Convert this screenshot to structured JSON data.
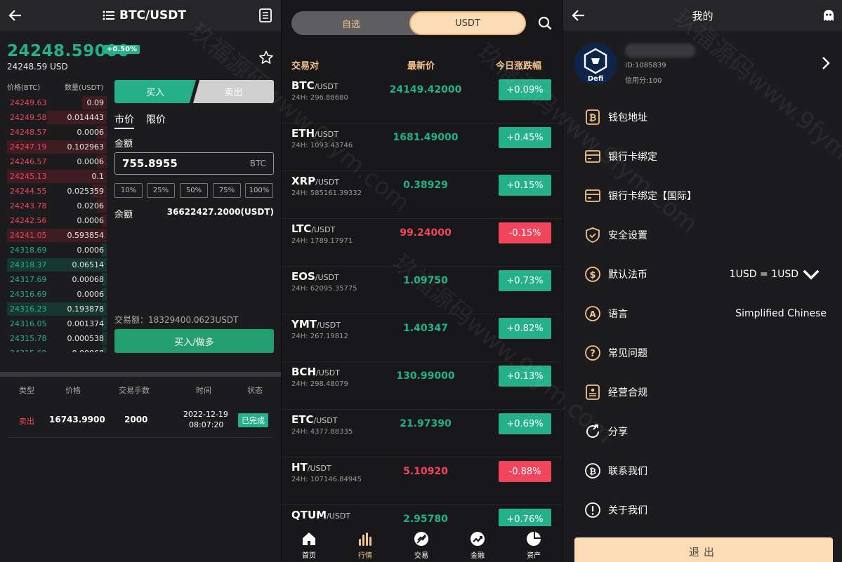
{
  "trade": {
    "title": "BTC/USDT",
    "price": "24248.59000",
    "change_badge": "+0.50%",
    "price_usd": "24248.59 USD",
    "orderbook_header": {
      "price": "价格(BTC)",
      "qty": "数量(USDT)"
    },
    "orderbook": [
      {
        "side": "sell",
        "price": "24249.63",
        "qty": "0.09",
        "depth": 0.25
      },
      {
        "side": "sell",
        "price": "24249.58",
        "qty": "0.014443",
        "depth": 0.6
      },
      {
        "side": "sell",
        "price": "24248.57",
        "qty": "0.0006",
        "depth": 0.1
      },
      {
        "side": "sell",
        "price": "24247.19",
        "qty": "0.102963",
        "depth": 1.0
      },
      {
        "side": "sell",
        "price": "24246.57",
        "qty": "0.0006",
        "depth": 0.1
      },
      {
        "side": "sell",
        "price": "24245.13",
        "qty": "0.1",
        "depth": 1.0
      },
      {
        "side": "sell",
        "price": "24244.55",
        "qty": "0.025359",
        "depth": 0.15
      },
      {
        "side": "sell",
        "price": "24243.78",
        "qty": "0.0206",
        "depth": 0.1
      },
      {
        "side": "sell",
        "price": "24242.56",
        "qty": "0.0006",
        "depth": 0.05
      },
      {
        "side": "sell",
        "price": "24241.05",
        "qty": "0.593854",
        "depth": 1.0
      },
      {
        "side": "buy",
        "price": "24318.69",
        "qty": "0.0006",
        "depth": 0.05
      },
      {
        "side": "buy",
        "price": "24318.37",
        "qty": "0.06514",
        "depth": 1.0
      },
      {
        "side": "buy",
        "price": "24317.69",
        "qty": "0.00068",
        "depth": 0.05
      },
      {
        "side": "buy",
        "price": "24316.69",
        "qty": "0.0006",
        "depth": 0.05
      },
      {
        "side": "buy",
        "price": "24316.23",
        "qty": "0.193878",
        "depth": 1.0
      },
      {
        "side": "buy",
        "price": "24316.05",
        "qty": "0.001374",
        "depth": 0.05
      },
      {
        "side": "buy",
        "price": "24315.78",
        "qty": "0.000538",
        "depth": 0.05
      },
      {
        "side": "buy",
        "price": "24315.69",
        "qty": "0.00068",
        "depth": 0.05
      }
    ],
    "buy_tab": "买入",
    "sell_tab": "卖出",
    "order_type_market": "市价",
    "order_type_limit": "限价",
    "amount_label": "金额",
    "amount_value": "755.8955",
    "amount_unit": "BTC",
    "pct_buttons": [
      "10%",
      "25%",
      "50%",
      "75%",
      "100%"
    ],
    "balance_label": "余额",
    "balance_value": "36622427.2000(USDT)",
    "volume_text": "交易额：18329400.0623USDT",
    "submit_label": "买入/做多",
    "history_headers": [
      "类型",
      "价格",
      "交易手数",
      "时间",
      "状态"
    ],
    "history_row": {
      "type": "卖出",
      "price": "16743.9900",
      "lots": "2000",
      "date": "2022-12-19",
      "time": "08:07:20",
      "status": "已完成"
    }
  },
  "market": {
    "tab_fav": "自选",
    "tab_usdt": "USDT",
    "headers": [
      "交易对",
      "最新价",
      "今日涨跌幅"
    ],
    "rows": [
      {
        "sym": "BTC",
        "quote": "/USDT",
        "vol": "24H: 296.88680",
        "price": "24149.42000",
        "chg": "+0.09%",
        "up": true
      },
      {
        "sym": "ETH",
        "quote": "/USDT",
        "vol": "24H: 1093.43746",
        "price": "1681.49000",
        "chg": "+0.45%",
        "up": true
      },
      {
        "sym": "XRP",
        "quote": "/USDT",
        "vol": "24H: 585161.39332",
        "price": "0.38929",
        "chg": "+0.15%",
        "up": true
      },
      {
        "sym": "LTC",
        "quote": "/USDT",
        "vol": "24H: 1789.17971",
        "price": "99.24000",
        "chg": "-0.15%",
        "up": false
      },
      {
        "sym": "EOS",
        "quote": "/USDT",
        "vol": "24H: 62095.35775",
        "price": "1.09750",
        "chg": "+0.73%",
        "up": true
      },
      {
        "sym": "YMT",
        "quote": "/USDT",
        "vol": "24H: 267.19812",
        "price": "1.40347",
        "chg": "+0.82%",
        "up": true
      },
      {
        "sym": "BCH",
        "quote": "/USDT",
        "vol": "24H: 298.48079",
        "price": "130.99000",
        "chg": "+0.13%",
        "up": true
      },
      {
        "sym": "ETC",
        "quote": "/USDT",
        "vol": "24H: 4377.88335",
        "price": "21.97390",
        "chg": "+0.69%",
        "up": true
      },
      {
        "sym": "HT",
        "quote": "/USDT",
        "vol": "24H: 107146.84945",
        "price": "5.10920",
        "chg": "-0.88%",
        "up": false
      },
      {
        "sym": "QTUM",
        "quote": "/USDT",
        "vol": "",
        "price": "2.95780",
        "chg": "+0.76%",
        "up": true
      }
    ],
    "tabbar": [
      {
        "label": "首页",
        "icon": "home-icon"
      },
      {
        "label": "行情",
        "icon": "market-icon"
      },
      {
        "label": "交易",
        "icon": "trade-icon"
      },
      {
        "label": "金融",
        "icon": "finance-icon"
      },
      {
        "label": "资产",
        "icon": "assets-icon"
      }
    ],
    "colors": {
      "up": "#25b08a",
      "down": "#f0455d",
      "accent": "#f5c48e"
    }
  },
  "profile": {
    "title": "我的",
    "avatar_text": "Defi",
    "user_id": "ID:1085839",
    "credit": "信用分:100",
    "menu": [
      {
        "label": "钱包地址",
        "icon": "bitcoin-wallet-icon",
        "value": ""
      },
      {
        "label": "银行卡绑定",
        "icon": "card-icon",
        "value": ""
      },
      {
        "label": "银行卡绑定【国际】",
        "icon": "card-icon",
        "value": ""
      },
      {
        "label": "安全设置",
        "icon": "shield-icon",
        "value": ""
      },
      {
        "label": "默认法币",
        "icon": "dollar-icon",
        "value": "1USD = 1USD"
      },
      {
        "label": "语言",
        "icon": "language-icon",
        "value": "Simplified Chinese"
      },
      {
        "label": "常见问题",
        "icon": "question-icon",
        "value": ""
      },
      {
        "label": "经营合规",
        "icon": "compliance-icon",
        "value": ""
      },
      {
        "label": "分享",
        "icon": "share-icon",
        "value": ""
      },
      {
        "label": "联系我们",
        "icon": "contact-icon",
        "value": ""
      },
      {
        "label": "关于我们",
        "icon": "about-icon",
        "value": ""
      }
    ],
    "logout": "退出"
  },
  "watermark": "玖福源码www.9fym.com"
}
